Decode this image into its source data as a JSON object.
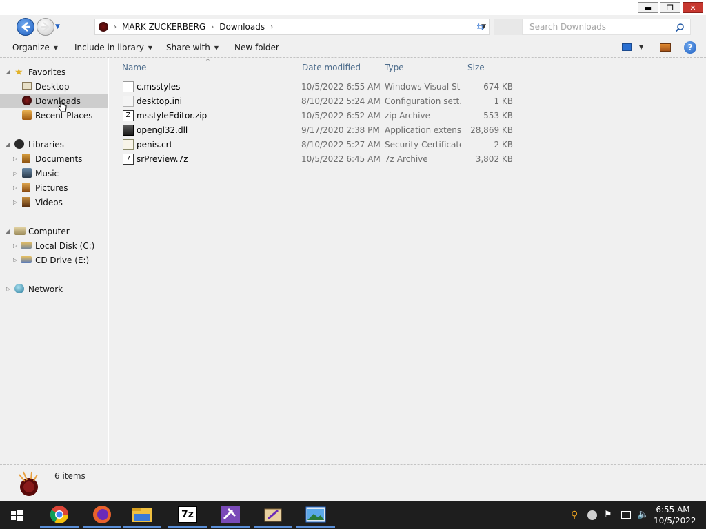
{
  "window": {
    "minimize": "▬",
    "restore": "❐",
    "close": "✕"
  },
  "address": {
    "crumbs": [
      "MARK ZUCKERBERG",
      "Downloads"
    ]
  },
  "search": {
    "placeholder": "Search Downloads"
  },
  "toolbar": {
    "organize": "Organize",
    "include_in_library": "Include in library",
    "share_with": "Share with",
    "new_folder": "New folder"
  },
  "nav": {
    "favorites": "Favorites",
    "desktop": "Desktop",
    "downloads": "Downloads",
    "recent_places": "Recent Places",
    "libraries": "Libraries",
    "documents": "Documents",
    "music": "Music",
    "pictures": "Pictures",
    "videos": "Videos",
    "computer": "Computer",
    "local_disk": "Local Disk (C:)",
    "cd_drive": "CD Drive (E:)",
    "network": "Network"
  },
  "columns": {
    "name": "Name",
    "date": "Date modified",
    "type": "Type",
    "size": "Size"
  },
  "files": [
    {
      "name": "c.msstyles",
      "date": "10/5/2022 6:55 AM",
      "type": "Windows Visual St...",
      "size": "674 KB",
      "icon": "msstyles-file-icon"
    },
    {
      "name": "desktop.ini",
      "date": "8/10/2022 5:24 AM",
      "type": "Configuration sett...",
      "size": "1 KB",
      "icon": "settings-file-icon"
    },
    {
      "name": "msstyleEditor.zip",
      "date": "10/5/2022 6:52 AM",
      "type": "zip Archive",
      "size": "553 KB",
      "icon": "zip-archive-icon"
    },
    {
      "name": "opengl32.dll",
      "date": "9/17/2020 2:38 PM",
      "type": "Application extens...",
      "size": "28,869 KB",
      "icon": "dll-file-icon"
    },
    {
      "name": "penis.crt",
      "date": "8/10/2022 5:27 AM",
      "type": "Security Certificate",
      "size": "2 KB",
      "icon": "certificate-icon"
    },
    {
      "name": "srPreview.7z",
      "date": "10/5/2022 6:45 AM",
      "type": "7z Archive",
      "size": "3,802 KB",
      "icon": "7z-archive-icon"
    }
  ],
  "status": {
    "count": "6 items"
  },
  "taskbar": {
    "apps": [
      "start-icon",
      "chrome-icon",
      "firefox-icon",
      "file-explorer-icon",
      "7zip-icon",
      "visual-studio-icon",
      "msstyle-editor-icon",
      "photos-icon"
    ],
    "time": "6:55 AM",
    "date": "10/5/2022"
  },
  "colors": {
    "accent": "#5a8fd8",
    "header_text": "#4e6d8c",
    "selection": "#cdcdcd",
    "close": "#c7372f"
  }
}
